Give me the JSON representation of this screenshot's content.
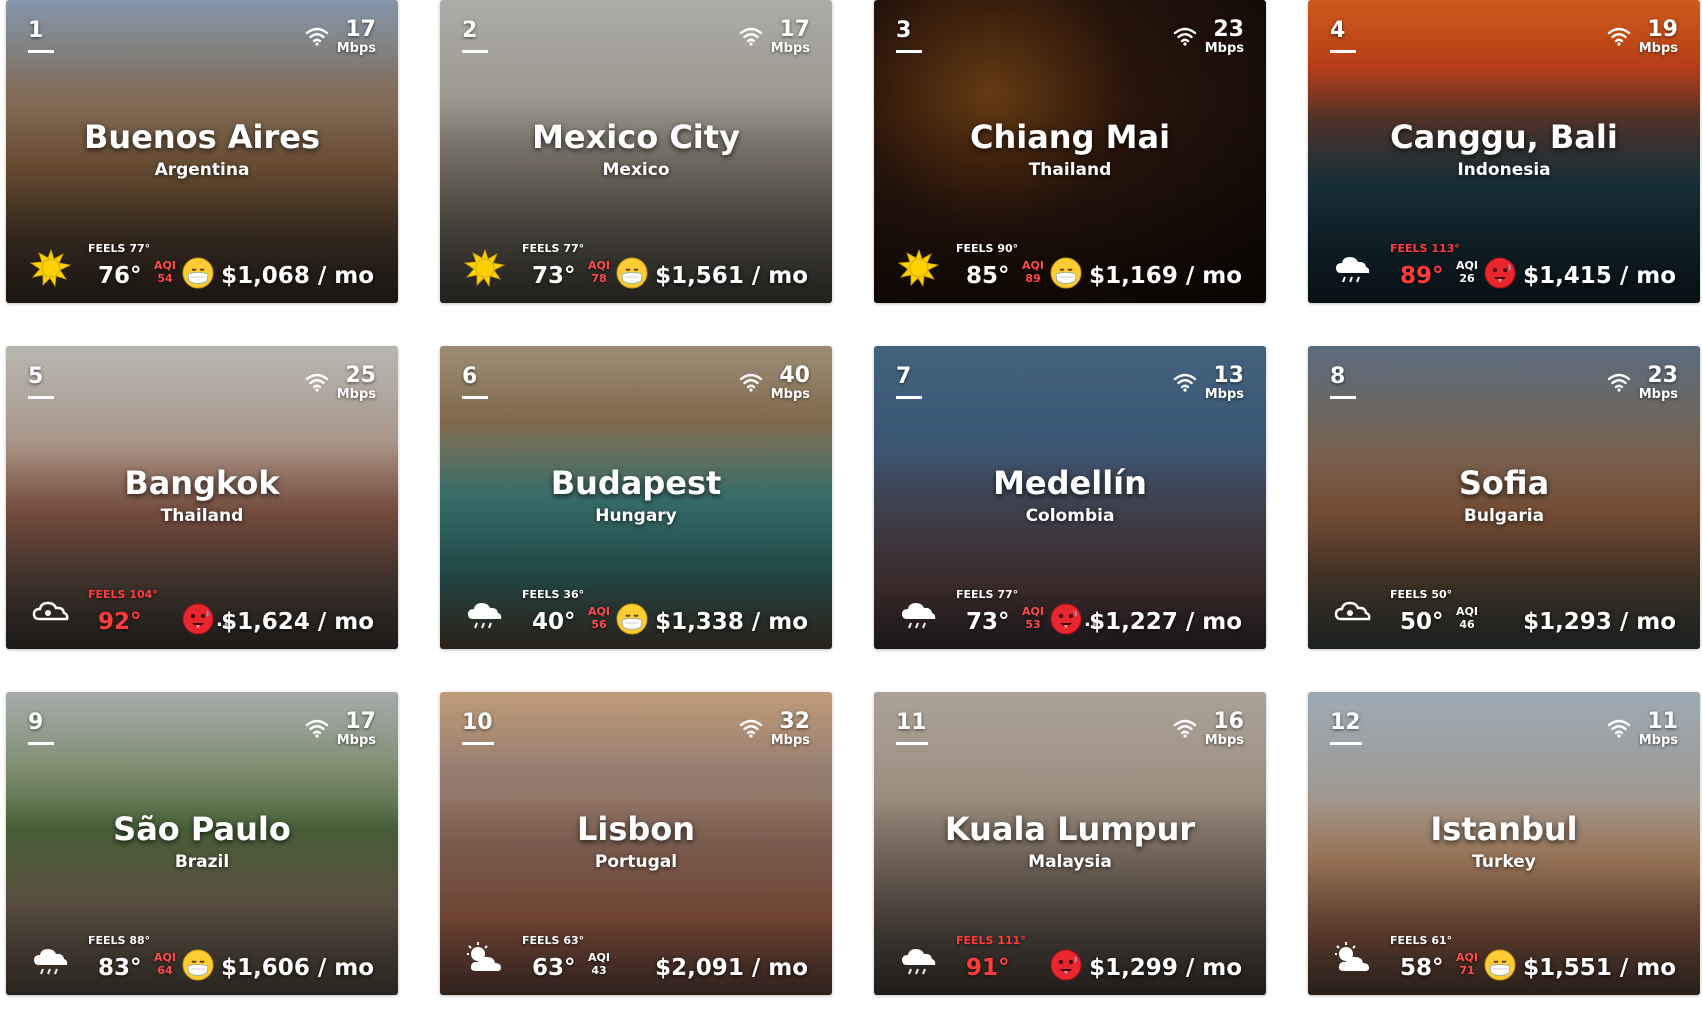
{
  "colors": {
    "accent": "#e8262d",
    "feels_hot": "#ff3b3b"
  },
  "labels": {
    "feels": "FEELS",
    "aqi": "AQI",
    "speed_unit": "Mbps"
  },
  "cities": [
    {
      "rank": "1",
      "speed": "17",
      "city": "Buenos Aires",
      "country": "Argentina",
      "weather": "sun-icon",
      "feels": "77°",
      "temp": "76°",
      "hot": false,
      "aqi": "54",
      "aqi_bad": true,
      "face": "mask-face-icon",
      "dots": "",
      "cost": "$1,068 / mo",
      "bg": "linear-gradient(180deg,#9ab0c8 0%,#8a7560 30%,#7a5a3a 55%,#4b3a2a 80%,#3a3028 100%)"
    },
    {
      "rank": "2",
      "speed": "17",
      "city": "Mexico City",
      "country": "Mexico",
      "weather": "sun-icon",
      "feels": "77°",
      "temp": "73°",
      "hot": false,
      "aqi": "78",
      "aqi_bad": true,
      "face": "mask-face-icon",
      "dots": "",
      "cost": "$1,561 / mo",
      "bg": "linear-gradient(180deg,#c9c8c4 0%,#a8a49b 30%,#7f786c 55%,#5e5a52 80%,#4a4640 100%)"
    },
    {
      "rank": "3",
      "speed": "23",
      "city": "Chiang Mai",
      "country": "Thailand",
      "weather": "sun-icon",
      "feels": "90°",
      "temp": "85°",
      "hot": false,
      "aqi": "89",
      "aqi_bad": true,
      "face": "mask-face-icon",
      "dots": "",
      "cost": "$1,169 / mo",
      "bg": "radial-gradient(circle at 30% 30%,#6b3d14 0%,#2a160b 40%,#120906 100%)"
    },
    {
      "rank": "4",
      "speed": "19",
      "city": "Canggu, Bali",
      "country": "Indonesia",
      "weather": "rain-icon",
      "feels": "113°",
      "temp": "89°",
      "hot": true,
      "aqi": "26",
      "aqi_bad": false,
      "face": "hot-face-icon",
      "dots": "",
      "cost": "$1,415 / mo",
      "bg": "linear-gradient(180deg,#f06a1e 0%,#c9421a 22%,#5a3628 38%,#1d3a46 60%,#10242e 100%)"
    },
    {
      "rank": "5",
      "speed": "25",
      "city": "Bangkok",
      "country": "Thailand",
      "weather": "cloud-icon",
      "feels": "104°",
      "temp": "92°",
      "hot": true,
      "aqi": "",
      "aqi_bad": false,
      "face": "hot-face-icon",
      "dots": "...",
      "cost": "$1,624 / mo",
      "bg": "linear-gradient(180deg,#d8d6d0 0%,#b4a294 30%,#8a5a48 55%,#5a4a40 80%,#3e3a36 100%)"
    },
    {
      "rank": "6",
      "speed": "40",
      "city": "Budapest",
      "country": "Hungary",
      "weather": "rain-icon",
      "feels": "36°",
      "temp": "40°",
      "hot": false,
      "aqi": "56",
      "aqi_bad": true,
      "face": "mask-face-icon",
      "dots": "",
      "cost": "$1,338 / mo",
      "bg": "linear-gradient(180deg,#b7a58a 0%,#8a7152 25%,#3f7d7a 50%,#2f6a68 75%,#5a4a3a 100%)"
    },
    {
      "rank": "7",
      "speed": "13",
      "city": "Medellín",
      "country": "Colombia",
      "weather": "rain-icon",
      "feels": "77°",
      "temp": "73°",
      "hot": false,
      "aqi": "53",
      "aqi_bad": true,
      "face": "hot-face-icon",
      "dots": "...",
      "cost": "$1,227 / mo",
      "bg": "linear-gradient(180deg,#4f7394 0%,#3d5d7c 30%,#4a4a5a 55%,#5a4040 80%,#3a3038 100%)"
    },
    {
      "rank": "8",
      "speed": "23",
      "city": "Sofia",
      "country": "Bulgaria",
      "weather": "cloud-icon",
      "feels": "50°",
      "temp": "50°",
      "hot": false,
      "aqi": "46",
      "aqi_bad": false,
      "face": "",
      "dots": "",
      "cost": "$1,293 / mo",
      "bg": "linear-gradient(180deg,#6b7f96 0%,#7a6a5a 30%,#8a5a3e 55%,#5a4836 80%,#3e4846 100%)"
    },
    {
      "rank": "9",
      "speed": "17",
      "city": "São Paulo",
      "country": "Brazil",
      "weather": "rain-icon",
      "feels": "88°",
      "temp": "83°",
      "hot": false,
      "aqi": "64",
      "aqi_bad": true,
      "face": "mask-face-icon",
      "dots": "",
      "cost": "$1,606 / mo",
      "bg": "linear-gradient(180deg,#c4c9ca 0%,#8a9a7a 25%,#4e6a3e 45%,#7a6a56 70%,#5a5044 100%)"
    },
    {
      "rank": "10",
      "speed": "32",
      "city": "Lisbon",
      "country": "Portugal",
      "weather": "sun-cloud-icon",
      "feels": "63°",
      "temp": "63°",
      "hot": false,
      "aqi": "43",
      "aqi_bad": false,
      "face": "",
      "dots": "",
      "cost": "$2,091 / mo",
      "bg": "linear-gradient(180deg,#e2b68e 0%,#a2897a 25%,#8a6a5a 50%,#a2624a 75%,#6a4a3e 100%)"
    },
    {
      "rank": "11",
      "speed": "16",
      "city": "Kuala Lumpur",
      "country": "Malaysia",
      "weather": "rain-icon",
      "feels": "111°",
      "temp": "91°",
      "hot": true,
      "aqi": "",
      "aqi_bad": false,
      "face": "hot-face-icon",
      "dots": "",
      "cost": "$1,299 / mo",
      "bg": "linear-gradient(180deg,#c9bdb2 0%,#a89a8a 30%,#857566 55%,#5e544c 80%,#463e38 100%)"
    },
    {
      "rank": "12",
      "speed": "11",
      "city": "Istanbul",
      "country": "Turkey",
      "weather": "sun-cloud-icon",
      "feels": "61°",
      "temp": "58°",
      "hot": false,
      "aqi": "71",
      "aqi_bad": true,
      "face": "mask-face-icon",
      "dots": "",
      "cost": "$1,551 / mo",
      "bg": "linear-gradient(180deg,#b8c8d4 0%,#a8a4a0 30%,#b48a68 55%,#8a5a44 80%,#5a4438 100%)"
    }
  ]
}
